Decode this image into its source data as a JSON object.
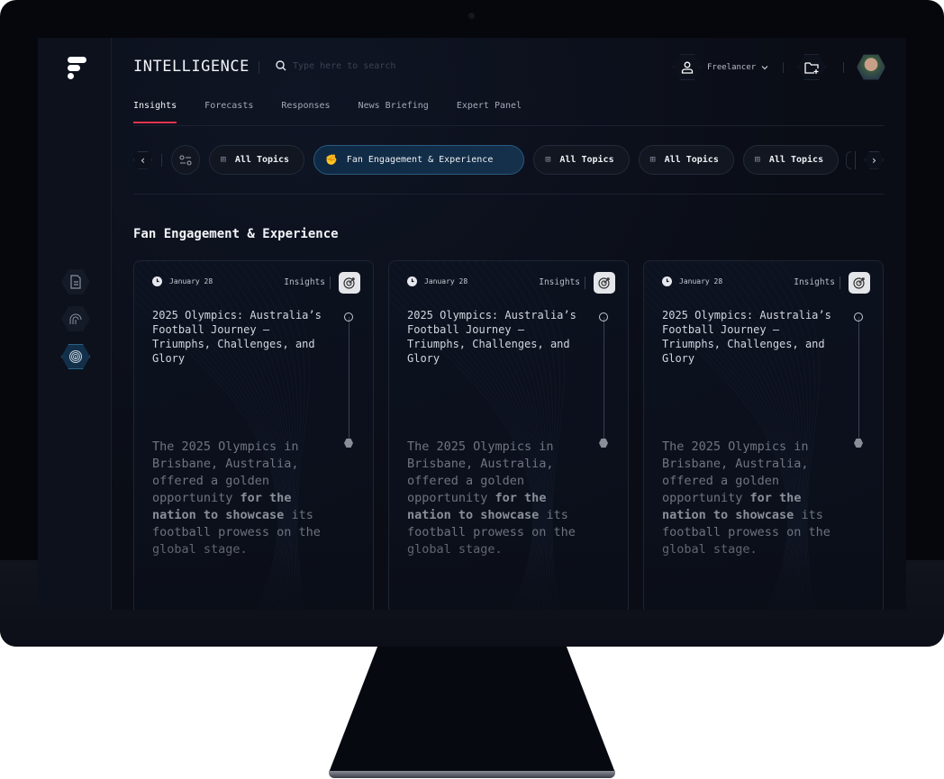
{
  "app": {
    "title": "INTELLIGENCE",
    "search_placeholder": "Type here to search"
  },
  "header": {
    "role_label": "Freelancer",
    "icons": [
      "user-icon",
      "chevron-down-icon",
      "folder-plus-icon",
      "avatar"
    ]
  },
  "tabs": [
    {
      "label": "Insights",
      "active": true
    },
    {
      "label": "Forecasts"
    },
    {
      "label": "Responses"
    },
    {
      "label": "News Briefing"
    },
    {
      "label": "Expert Panel"
    }
  ],
  "chips": [
    {
      "label": "All Topics",
      "icon": "grid-icon"
    },
    {
      "label": "Fan Engagement & Experience",
      "icon": "fan-icon",
      "active": true
    },
    {
      "label": "All Topics",
      "icon": "grid-icon"
    },
    {
      "label": "All Topics",
      "icon": "grid-icon"
    },
    {
      "label": "All Topics",
      "icon": "grid-icon"
    }
  ],
  "sidebar": {
    "items": [
      {
        "icon": "document-icon"
      },
      {
        "icon": "partial-fingerprint-icon"
      },
      {
        "icon": "fingerprint-icon",
        "active": true
      }
    ]
  },
  "section": {
    "title": "Fan Engagement & Experience"
  },
  "cards": [
    {
      "date": "January 28",
      "category": "Insights",
      "title": "2025 Olympics: Australia’s Football Journey – Triumphs, Challenges, and Glory",
      "body_pre": "The 2025 Olympics in Brisbane, Australia, offered a golden opportunity ",
      "body_bold": "for the nation to showcase",
      "body_post": " its football prowess on the global stage."
    },
    {
      "date": "January 28",
      "category": "Insights",
      "title": "2025 Olympics: Australia’s Football Journey – Triumphs, Challenges, and Glory",
      "body_pre": "The 2025 Olympics in Brisbane, Australia, offered a golden opportunity ",
      "body_bold": "for the nation to showcase",
      "body_post": " its football prowess on the global stage."
    },
    {
      "date": "January 28",
      "category": "Insights",
      "title": "2025 Olympics: Australia’s Football Journey – Triumphs, Challenges, and Glory",
      "body_pre": "The 2025 Olympics in Brisbane, Australia, offered a golden opportunity ",
      "body_bold": "for the nation to showcase",
      "body_post": " its football prowess on the global stage."
    }
  ],
  "colors": {
    "accent": "#e0344c",
    "active_chip": "#0f2a44",
    "background": "#0a0d16"
  }
}
